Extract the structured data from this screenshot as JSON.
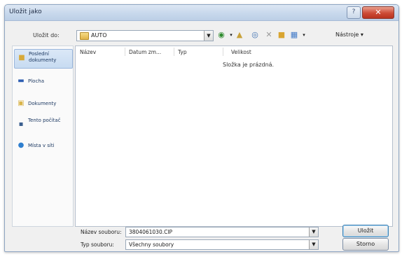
{
  "window": {
    "title": "Uložit jako",
    "help_glyph": "?",
    "close_glyph": "✕"
  },
  "toolbar": {
    "save_in_label": "Uložit do:",
    "location": "AUTO",
    "dropdown_glyph": "▼",
    "tools_label": "Nástroje ▾",
    "icons": [
      "back-arrow-icon",
      "up-folder-icon",
      "search-web-icon",
      "delete-icon",
      "new-folder-icon",
      "views-icon"
    ]
  },
  "places": [
    {
      "label": "Poslední dokumenty",
      "icon": "recent-documents-icon"
    },
    {
      "label": "Plocha",
      "icon": "desktop-icon"
    },
    {
      "label": "Dokumenty",
      "icon": "documents-icon"
    },
    {
      "label": "Tento počítač",
      "icon": "computer-icon"
    },
    {
      "label": "Místa v síti",
      "icon": "network-icon"
    }
  ],
  "filelist": {
    "columns": [
      "Název",
      "Datum zm...",
      "Typ",
      "Velikost"
    ],
    "empty_message": "Složka je prázdná."
  },
  "form": {
    "filename_label": "Název souboru:",
    "filename_value": "3804061030.CIP",
    "filetype_label": "Typ souboru:",
    "filetype_value": "Všechny soubory"
  },
  "buttons": {
    "save": "Uložit",
    "cancel": "Storno"
  }
}
